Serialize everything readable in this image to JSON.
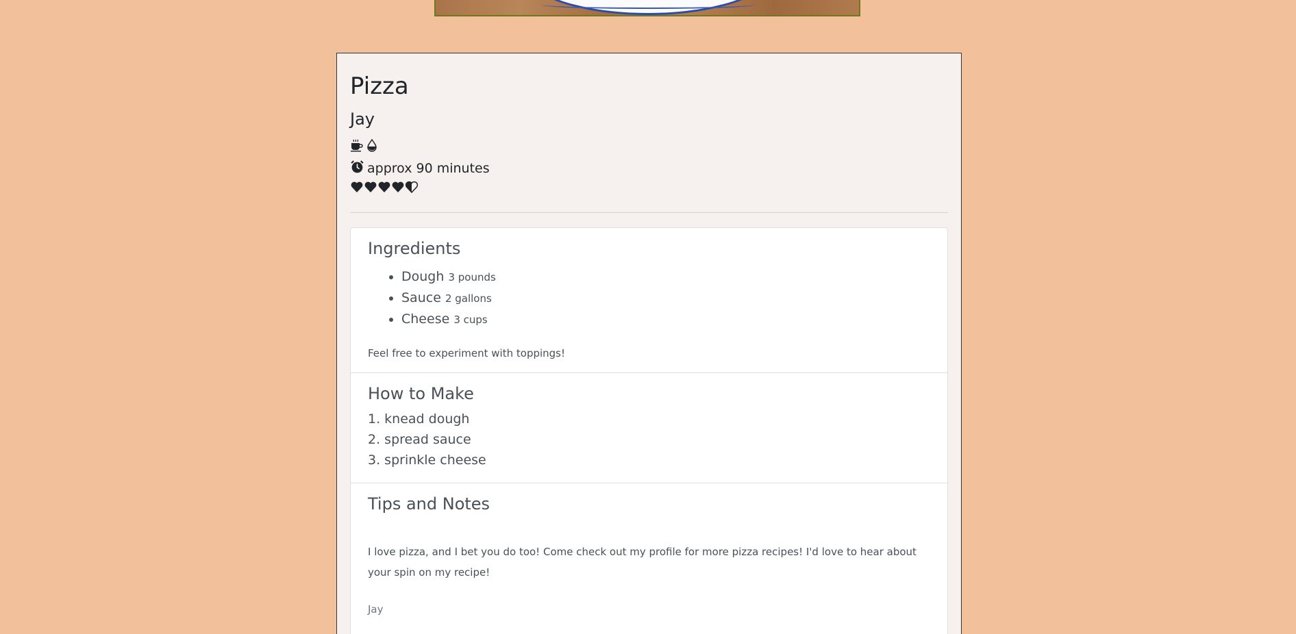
{
  "recipe": {
    "title": "Pizza",
    "author": "Jay",
    "diet_icons": [
      "coffee-cup-icon",
      "droplet-icon"
    ],
    "time_text": "approx 90 minutes",
    "rating": 4.5,
    "rating_max": 5
  },
  "ingredients": {
    "heading": "Ingredients",
    "items": [
      {
        "name": "Dough",
        "qty": "3 pounds"
      },
      {
        "name": "Sauce",
        "qty": "2 gallons"
      },
      {
        "name": "Cheese",
        "qty": "3 cups"
      }
    ],
    "note": "Feel free to experiment with toppings!"
  },
  "how_to_make": {
    "heading": "How to Make",
    "steps": [
      "1. knead dough",
      "2. spread sauce",
      "3. sprinkle cheese"
    ]
  },
  "tips": {
    "heading": "Tips and Notes",
    "text": "I love pizza, and I bet you do too! Come check out my profile for more pizza recipes! I'd love to hear about your spin on my recipe!",
    "signature": "Jay"
  },
  "colors": {
    "background": "#f3c09c",
    "card": "#f6f1ef",
    "hero_border": "#6b7a1e"
  }
}
